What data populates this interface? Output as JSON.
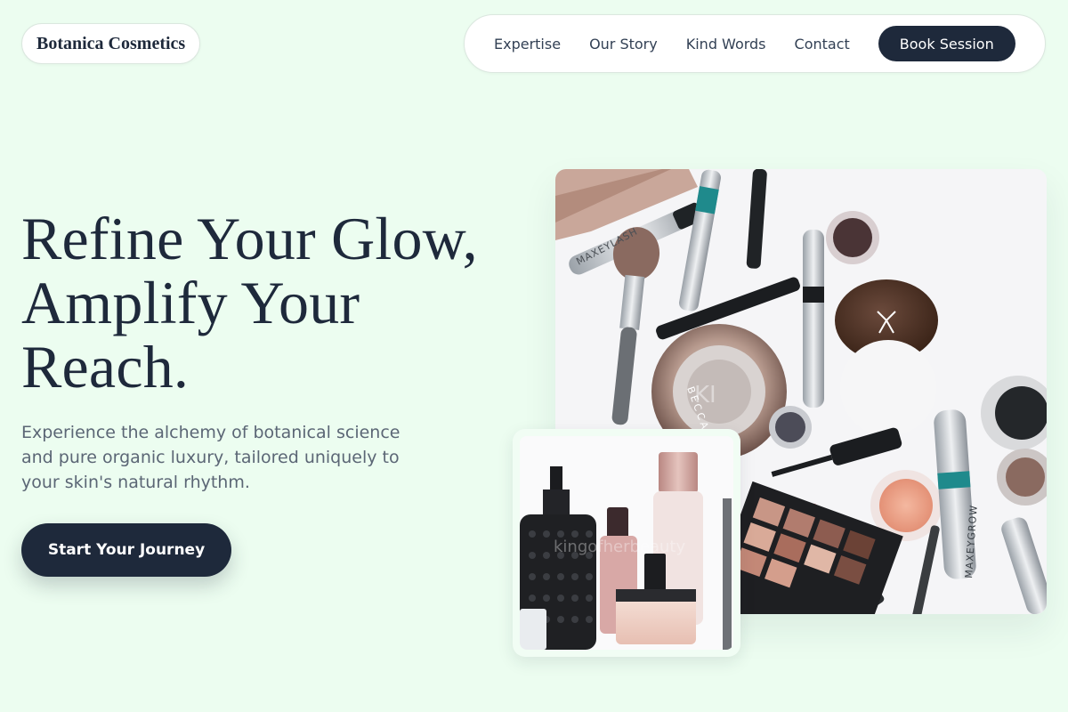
{
  "brand": {
    "name": "Botanica Cosmetics"
  },
  "nav": {
    "items": [
      "Expertise",
      "Our Story",
      "Kind Words",
      "Contact"
    ],
    "cta": "Book Session"
  },
  "hero": {
    "headline_lines": [
      "Refine Your Glow,",
      "Amplify Your",
      "Reach."
    ],
    "subtext_lines": [
      "Experience the alchemy of botanical science",
      "and pure organic luxury, tailored uniquely to",
      "your skin's natural rhythm."
    ],
    "cta": "Start Your Journey"
  },
  "images": {
    "main": {
      "watermark": "KI",
      "product_text": [
        "MAXEYLASH",
        "MAXEYGROW",
        "BECCA"
      ]
    },
    "secondary": {
      "watermark": "kingofherbeauty"
    }
  },
  "colors": {
    "background": "#ecfdf0",
    "dark": "#1e293b",
    "text_muted": "#5b6675",
    "white": "#ffffff"
  }
}
